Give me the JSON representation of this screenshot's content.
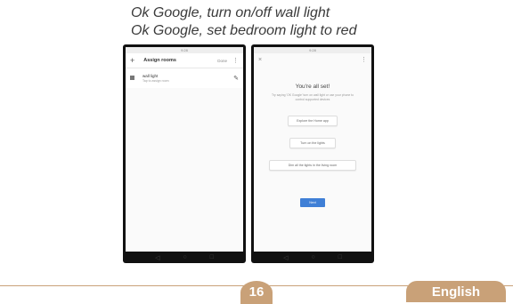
{
  "voice_commands": [
    "Ok Google, turn on/off wall light",
    "Ok Google, set bedroom light to red"
  ],
  "left_screen": {
    "status_text": "9:28",
    "header_title": "Assign rooms",
    "done_label": "Done",
    "device": {
      "name": "wall light",
      "subtitle": "Tap to assign room"
    }
  },
  "right_screen": {
    "status_text": "9:28",
    "title": "You're all set!",
    "description": "Try saying 'OK Google' turn on wall light or use your phone to control supported devices",
    "buttons": [
      "Explore the Home app",
      "Turn on the lights",
      "Dim all the lights in the living room"
    ],
    "next_label": "Next"
  },
  "footer": {
    "page_number": "16",
    "language": "English"
  },
  "colors": {
    "accent": "#c9a178",
    "button_blue": "#3f7fd6"
  }
}
